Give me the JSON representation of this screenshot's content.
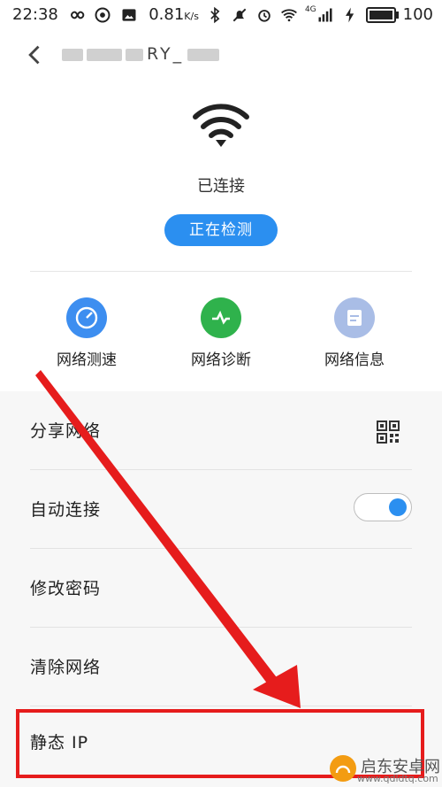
{
  "statusbar": {
    "time": "22:38",
    "net_speed": "0.81",
    "net_unit": "K/s",
    "signal_label": "4G",
    "battery": "100"
  },
  "header": {
    "title_visible": "RY_"
  },
  "status": {
    "connected_text": "已连接",
    "detect_button": "正在检测"
  },
  "tools": [
    {
      "label": "网络测速",
      "icon": "speedometer-icon",
      "color": "#3d8ef0"
    },
    {
      "label": "网络诊断",
      "icon": "pulse-icon",
      "color": "#2fb24c"
    },
    {
      "label": "网络信息",
      "icon": "info-card-icon",
      "color": "#a9bde6"
    }
  ],
  "settings": {
    "share_network": "分享网络",
    "auto_connect": "自动连接",
    "auto_connect_on": true,
    "change_password": "修改密码",
    "forget_network": "清除网络",
    "static_ip": "静态 IP"
  },
  "watermark": {
    "name": "启东安卓网",
    "url": "www.qdldtq.com"
  },
  "colors": {
    "accent": "#2b8ff0",
    "annotation_red": "#e61c1c"
  }
}
